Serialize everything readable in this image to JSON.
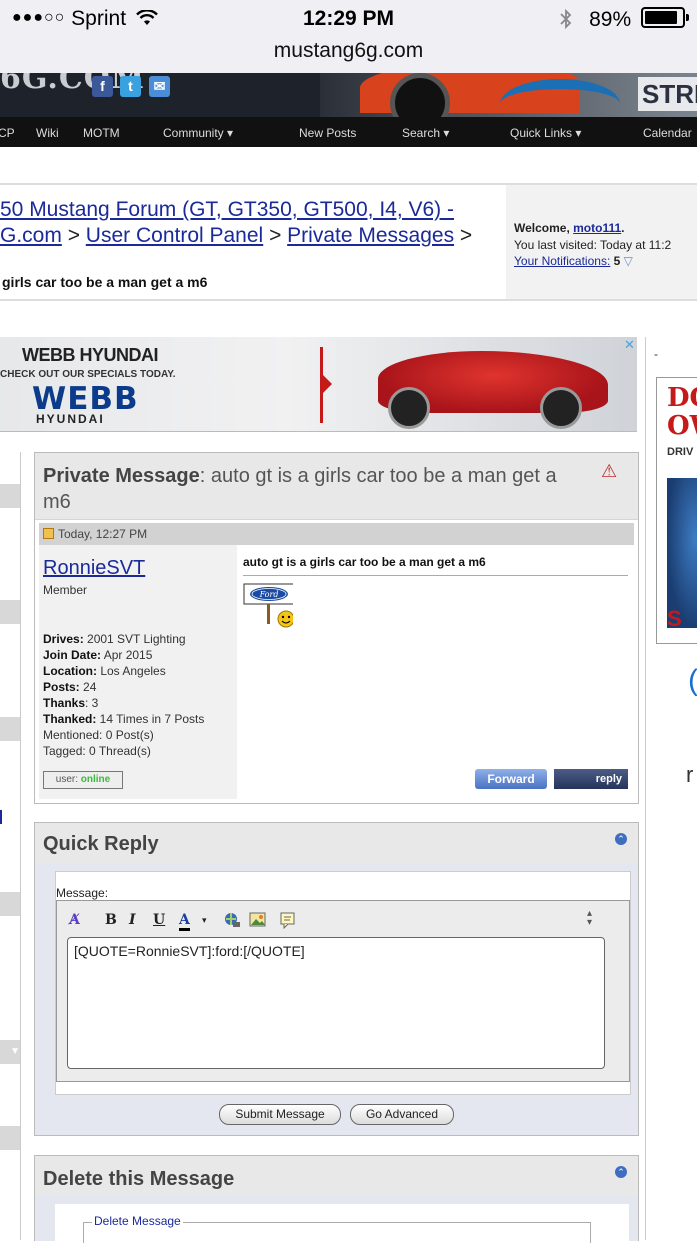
{
  "status_bar": {
    "signal": "●●●○○",
    "carrier": "Sprint",
    "time": "12:29 PM",
    "battery": "89%"
  },
  "browser": {
    "url": "mustang6g.com"
  },
  "header": {
    "logo_fragment": "6G.COM",
    "banner_text": "STRE",
    "social": [
      "f",
      "t",
      "✉"
    ]
  },
  "nav": {
    "items": [
      "CP",
      "Wiki",
      "MOTM",
      "Community ▾",
      "New Posts",
      "Search ▾",
      "Quick Links ▾",
      "Calendar"
    ]
  },
  "breadcrumb": {
    "line1": "50 Mustang Forum (GT, GT350, GT500, I4, V6) -",
    "line2_part0": "G.com",
    "link_ucp": "User Control Panel",
    "link_pm": "Private Messages",
    "sep": ">",
    "page_title": "girls car too be a man get a m6"
  },
  "welcome": {
    "prefix": "Welcome, ",
    "username": "moto111",
    "suffix": ".",
    "last_visited": "You last visited: Today at 11:2",
    "notifications_label": "Your Notifications:",
    "notifications_count": "5"
  },
  "ad": {
    "brand": "WEBB HYUNDAI",
    "tagline": "CHECK OUT OUR SPECIALS TODAY.",
    "logo": "WEBB",
    "sublogo": "HYUNDAI",
    "close": "✕"
  },
  "right_ad": {
    "dash": "-",
    "line1": "DO",
    "line2": "OW",
    "line3": "DRIV",
    "badge": "S",
    "paren": "(",
    "r": "r"
  },
  "pm": {
    "header_label": "Private Message",
    "header_colon": ": ",
    "subject": "auto gt is a girls car too be a man get a m6",
    "date": "Today, 12:27 PM",
    "sender": "RonnieSVT",
    "role": "Member",
    "stats": [
      {
        "label": "Drives:",
        "value": " 2001 SVT Lighting",
        "bold": true
      },
      {
        "label": "Join Date:",
        "value": " Apr 2015",
        "bold": true
      },
      {
        "label": "Location:",
        "value": " Los Angeles",
        "bold": true
      },
      {
        "label": "Posts:",
        "value": " 24",
        "bold": true
      },
      {
        "label": "Thanks",
        "value": ": 3",
        "bold": true
      },
      {
        "label": "Thanked:",
        "value": " 14 Times in 7 Posts",
        "bold": true
      },
      {
        "label": "",
        "value": "Mentioned: 0 Post(s)",
        "bold": false
      },
      {
        "label": "",
        "value": "Tagged: 0 Thread(s)",
        "bold": false
      }
    ],
    "online_prefix": "user: ",
    "online_status": "online",
    "body_title": "auto gt is a girls car too be a man get a m6",
    "smiley_sign": "Ford",
    "btn_forward": "Forward",
    "btn_reply": "reply"
  },
  "quick_reply": {
    "title": "Quick Reply",
    "message_label": "Message:",
    "textarea_value": "[QUOTE=RonnieSVT]:ford:[/QUOTE]",
    "submit": "Submit Message",
    "advanced": "Go Advanced"
  },
  "delete": {
    "title": "Delete this Message",
    "fieldset_legend": "Delete Message"
  }
}
